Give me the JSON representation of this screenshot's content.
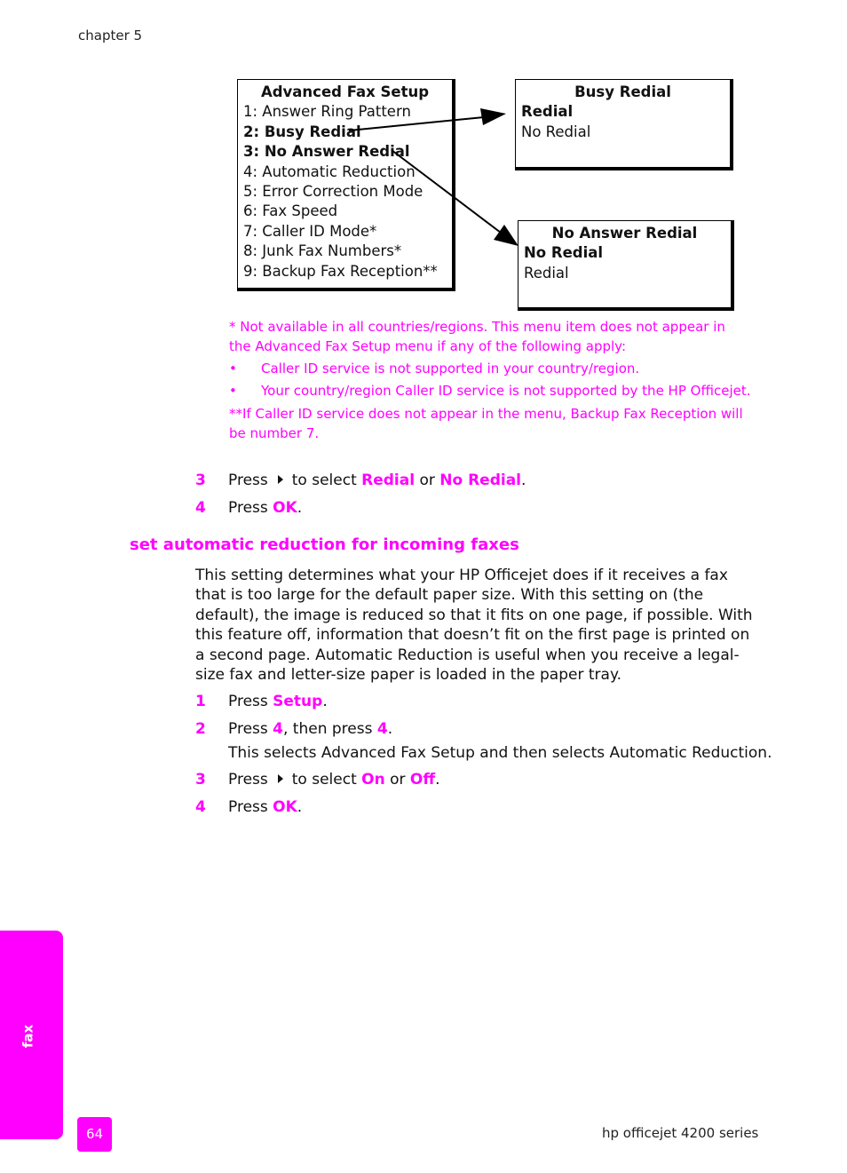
{
  "header": {
    "chapter": "chapter 5"
  },
  "diagram": {
    "menu": {
      "title": "Advanced Fax Setup",
      "items": [
        {
          "label": "1: Answer Ring Pattern",
          "bold": false
        },
        {
          "label": "2: Busy Redial",
          "bold": true
        },
        {
          "label": "3: No Answer Redial",
          "bold": true
        },
        {
          "label": "4: Automatic Reduction",
          "bold": false
        },
        {
          "label": "5: Error Correction Mode",
          "bold": false
        },
        {
          "label": "6: Fax Speed",
          "bold": false
        },
        {
          "label": "7: Caller ID Mode*",
          "bold": false
        },
        {
          "label": "8: Junk Fax Numbers*",
          "bold": false
        },
        {
          "label": "9: Backup Fax Reception**",
          "bold": false
        }
      ]
    },
    "busy_redial": {
      "title": "Busy Redial",
      "options": [
        "Redial",
        "No Redial"
      ]
    },
    "no_answer_redial": {
      "title": "No Answer Redial",
      "options": [
        "No Redial",
        "Redial"
      ]
    }
  },
  "notes": {
    "note1": "* Not available in all countries/regions. This menu item does not appear in the Advanced Fax Setup menu if any of the following apply:",
    "bullet_char": "•",
    "bullets": [
      "Caller ID service is not supported in your country/region.",
      "Your country/region Caller ID service is not supported by the HP Officejet."
    ],
    "note2": "**If Caller ID service does not appear in the menu, Backup Fax Reception will be number 7."
  },
  "steps_a": [
    {
      "num": "3",
      "pre": "Press",
      "arrow": "right-arrow-icon",
      "mid": "to select",
      "k1": "Redial",
      "conj": "or",
      "k2": "No Redial",
      "end": "."
    },
    {
      "num": "4",
      "pre": "Press",
      "k1": "OK",
      "end": "."
    }
  ],
  "section": {
    "heading": "set automatic reduction for incoming faxes",
    "paragraph": "This setting determines what your HP Officejet does if it receives a fax that is too large for the default paper size. With this setting on (the default), the image is reduced so that it fits on one page, if possible. With this feature off, information that doesn’t fit on the first page is printed on a second page. Automatic Reduction is useful when you receive a legal-size fax and letter-size paper is loaded in the paper tray.",
    "steps": [
      {
        "num": "1",
        "pre": "Press",
        "k1": "Setup",
        "end": "."
      },
      {
        "num": "2",
        "pre": "Press",
        "k1": "4",
        "mid": ", then press",
        "k2": "4",
        "end": ".",
        "sub": "This selects Advanced Fax Setup and then selects Automatic Reduction."
      },
      {
        "num": "3",
        "pre": "Press",
        "mid": "to select",
        "k1": "On",
        "conj": "or",
        "k2": "Off",
        "end": "."
      },
      {
        "num": "4",
        "pre": "Press",
        "k1": "OK",
        "end": "."
      }
    ]
  },
  "side_tab": {
    "label": "fax"
  },
  "footer": {
    "page": "64",
    "product": "hp officejet 4200 series"
  },
  "colors": {
    "accent": "#ff00ff",
    "text": "#111111"
  }
}
